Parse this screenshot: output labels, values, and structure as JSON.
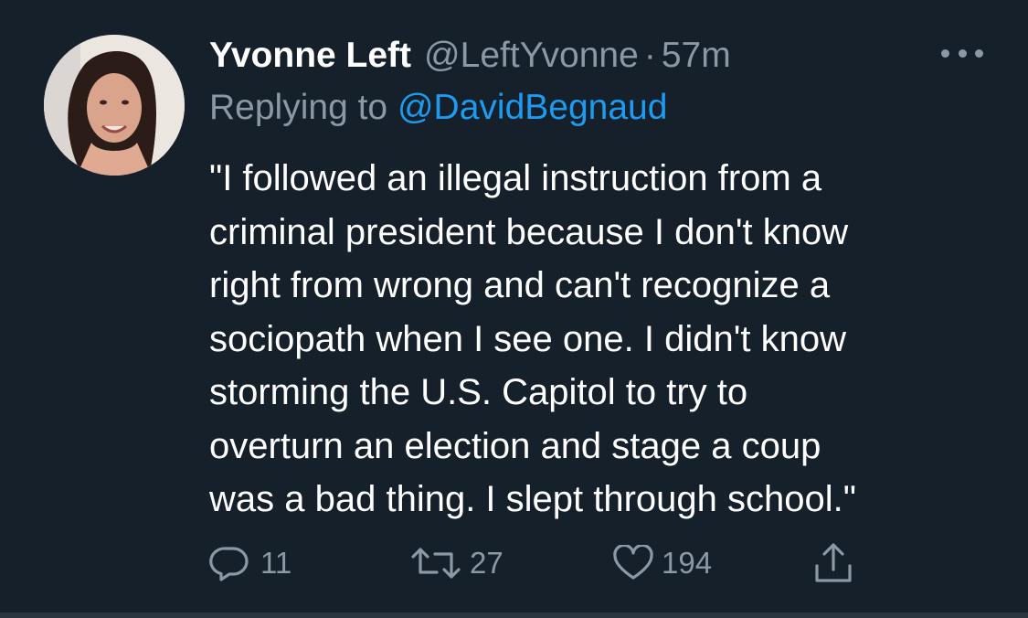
{
  "tweet": {
    "author": {
      "display_name": "Yvonne Left",
      "handle": "@LeftYvonne",
      "separator": "·",
      "timestamp": "57m"
    },
    "reply": {
      "prefix": "Replying to ",
      "to_handle": "@DavidBegnaud"
    },
    "body_lines": [
      "\"I followed an illegal instruction from a",
      "criminal president because I don't know",
      "right from wrong and can't recognize a",
      "sociopath when I see one. I didn't know",
      "storming the U.S. Capitol to try to",
      "overturn an election and stage a coup",
      "was a bad thing. I slept through school.\""
    ],
    "actions": {
      "reply_count": "11",
      "retweet_count": "27",
      "like_count": "194"
    }
  },
  "icons": {
    "more": "more-dots-icon",
    "reply": "speech-bubble-icon",
    "retweet": "retweet-arrows-icon",
    "like": "heart-icon",
    "share": "share-upload-icon"
  },
  "colors": {
    "background": "#15202b",
    "text_primary": "#ffffff",
    "text_secondary": "#8b98a5",
    "link": "#1d9bf0"
  }
}
